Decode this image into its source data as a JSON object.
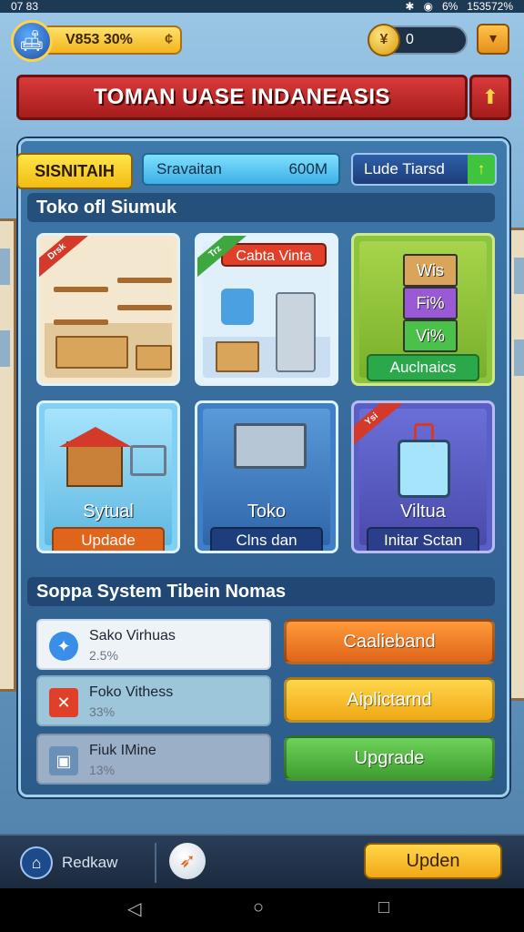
{
  "status_bar": {
    "left": "07 83",
    "right_icons": [
      "bluetooth-icon",
      "wifi-icon"
    ],
    "battery": "6%",
    "time": "153572%"
  },
  "top": {
    "coins": "V853 30%",
    "coins_plus": "¢",
    "gems": "0",
    "menu_glyph": "▾"
  },
  "title": {
    "text": "TOMAN UASE  INDANEASIS",
    "icon": "⬆"
  },
  "header": {
    "tag": "SISNITAIH",
    "info_label": "Sravaitan",
    "info_value": "600M",
    "trend_label": "Lude Tiarsd",
    "trend_arrow": "↑"
  },
  "section1": {
    "title": "Toko ofl Siumuk"
  },
  "cards": [
    {
      "ribbon": "Drsk",
      "label": "",
      "button": ""
    },
    {
      "ribbon": "Trz",
      "label": "Cabta Vinta",
      "button": ""
    },
    {
      "ribbon": "",
      "label": "",
      "button": "Auclnaics",
      "boxes": [
        "Wis",
        "Fi%",
        "Vi%"
      ]
    },
    {
      "ribbon": "",
      "label": "Sytual",
      "button": "Updade"
    },
    {
      "ribbon": "",
      "label": "Toko",
      "button": "Clns dan"
    },
    {
      "ribbon": "Ysi",
      "label": "Viltua",
      "button": "Initar Sctan"
    }
  ],
  "section2": {
    "title": "Soppa System Tibein Nomas"
  },
  "list": [
    {
      "name": "Sako Virhuas",
      "pct": "2.5%"
    },
    {
      "name": "Foko Vithess",
      "pct": "33%"
    },
    {
      "name": "Fiuk IMine",
      "pct": "13%"
    }
  ],
  "actions": [
    "Caalieband",
    "Aiplictarnd",
    "Upgrade"
  ],
  "bottom": {
    "label": "Redkaw",
    "update": "Upden"
  },
  "nav": {
    "back": "◁",
    "home": "○",
    "recent": "□"
  },
  "colors": {
    "title_red": "#c62828",
    "accent_yellow": "#f2bc12",
    "panel_blue": "#2c5b8a"
  }
}
